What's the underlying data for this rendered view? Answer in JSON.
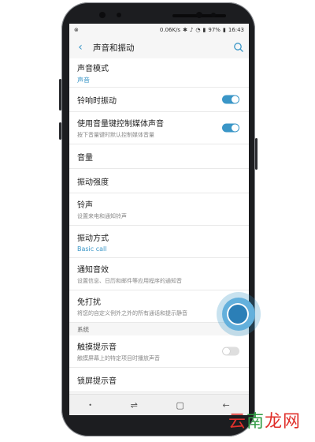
{
  "status_bar": {
    "speed": "0.06K/s",
    "battery": "97%",
    "time": "16:43"
  },
  "app_bar": {
    "title": "声音和振动"
  },
  "settings": [
    {
      "title": "声音模式",
      "value": "声音"
    },
    {
      "title": "铃响时振动",
      "toggle": "on"
    },
    {
      "title": "使用音量键控制媒体声音",
      "subtitle": "按下音量键时默认控制媒体音量",
      "toggle": "on"
    },
    {
      "title": "音量"
    },
    {
      "title": "振动强度"
    },
    {
      "title": "铃声",
      "subtitle": "设置来电和通知铃声"
    },
    {
      "title": "振动方式",
      "value": "Basic call"
    },
    {
      "title": "通知音效",
      "subtitle": "设置信息、日历和邮件等应用程序的通知音"
    },
    {
      "title": "免打扰",
      "subtitle": "将您的自定义例外之外的所有通话和提示静音"
    }
  ],
  "section_system": "系统",
  "system_settings": [
    {
      "title": "触摸提示音",
      "subtitle": "触摸屏幕上的特定项目时播放声音",
      "toggle": "off"
    },
    {
      "title": "锁屏提示音"
    }
  ],
  "accent_color": "#3a96c7",
  "watermark": {
    "part1": "云",
    "part2": "南",
    "part3": "龙网"
  }
}
